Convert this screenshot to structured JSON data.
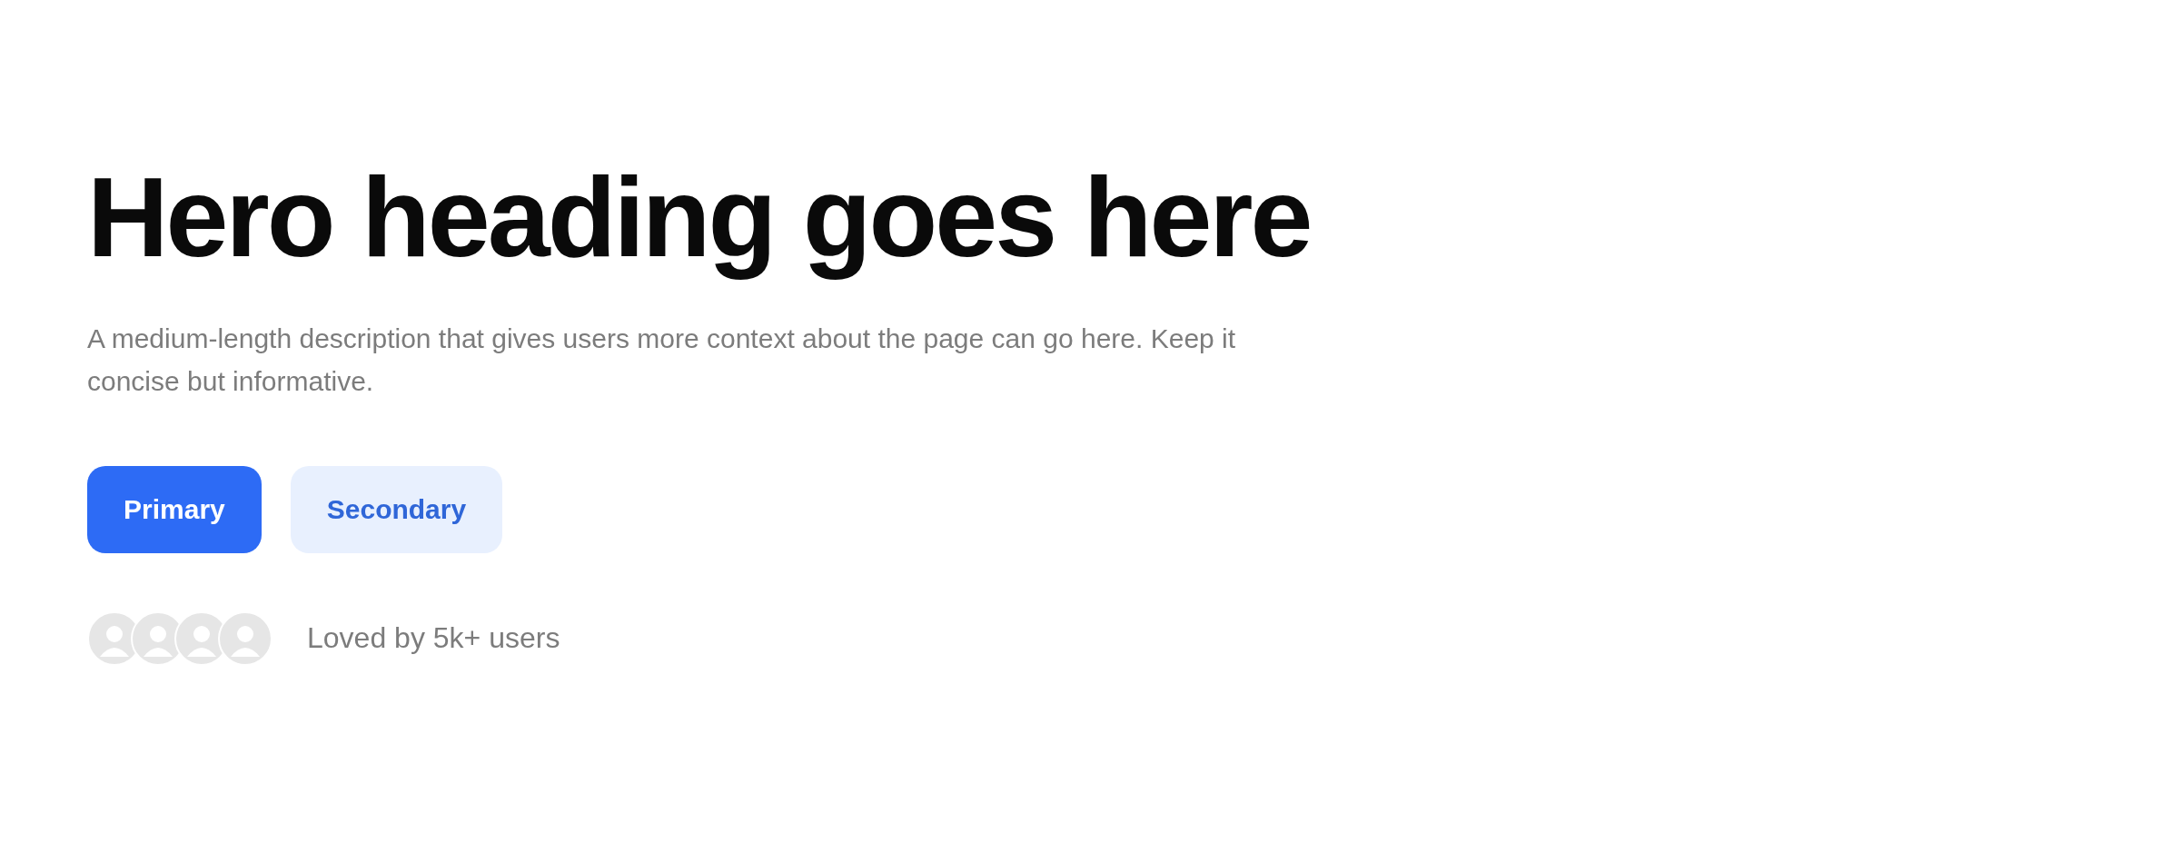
{
  "hero": {
    "heading": "Hero heading goes here",
    "description": "A medium-length description that gives users more context about the page can go here. Keep it concise but informative.",
    "buttons": [
      {
        "label": "Primary",
        "kind": "primary"
      },
      {
        "label": "Secondary",
        "kind": "secondary"
      }
    ],
    "social_proof": {
      "avatars": [
        {
          "kind": "placeholder"
        },
        {
          "kind": "placeholder"
        },
        {
          "kind": "placeholder"
        },
        {
          "kind": "placeholder"
        }
      ],
      "text": "Loved by 5k+ users"
    }
  }
}
